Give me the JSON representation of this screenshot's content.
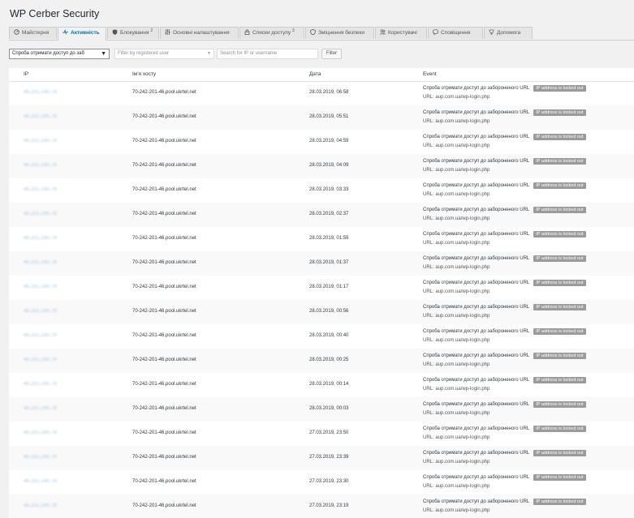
{
  "app": {
    "title": "WP Cerber Security"
  },
  "tabs": [
    {
      "label": "Майстерня",
      "icon": "dashboard-icon",
      "sup": ""
    },
    {
      "label": "Активність",
      "icon": "activity-pulse-icon",
      "sup": ""
    },
    {
      "label": "Блокування",
      "icon": "shield-icon",
      "sup": "2"
    },
    {
      "label": "Основні налаштування",
      "icon": "sliders-icon",
      "sup": ""
    },
    {
      "label": "Списки доступу",
      "icon": "lock-icon",
      "sup": "3"
    },
    {
      "label": "Зміцнення безпеки",
      "icon": "shield-outline-icon",
      "sup": ""
    },
    {
      "label": "Користувачі",
      "icon": "users-icon",
      "sup": ""
    },
    {
      "label": "Сповіщення",
      "icon": "chat-bubble-icon",
      "sup": ""
    },
    {
      "label": "Допомога",
      "icon": "lightbulb-icon",
      "sup": ""
    }
  ],
  "filters": {
    "activity_select": "Спроба отримати доступ до заб",
    "user_select_placeholder": "Filter by registered user",
    "search_placeholder": "Search for IP or username",
    "filter_button": "Filter"
  },
  "table": {
    "columns": {
      "ip": "IP",
      "host": "Ім'я хосту",
      "date": "Дата",
      "event": "Event"
    },
    "event_text": "Спроба отримати доступ до забороненого URL",
    "badge": "IP address is locked out",
    "url": "URL: aup.com.ua/wp-login.php",
    "ip_blurred": "46.201.240.79",
    "host": "70-242-201-46.pool.ukrtel.net",
    "rows": [
      {
        "date": "28.03.2019, 06:58"
      },
      {
        "date": "28.03.2019, 05:51"
      },
      {
        "date": "28.03.2019, 04:59"
      },
      {
        "date": "28.03.2019, 04:09"
      },
      {
        "date": "28.03.2019, 03:33"
      },
      {
        "date": "28.03.2019, 02:37"
      },
      {
        "date": "28.03.2019, 01:59"
      },
      {
        "date": "28.03.2019, 01:37"
      },
      {
        "date": "28.03.2019, 01:17"
      },
      {
        "date": "28.03.2019, 00:56"
      },
      {
        "date": "28.03.2019, 00:40"
      },
      {
        "date": "28.03.2019, 00:25"
      },
      {
        "date": "28.03.2019, 00:14"
      },
      {
        "date": "28.03.2019, 00:03"
      },
      {
        "date": "27.03.2019, 23:50"
      },
      {
        "date": "27.03.2019, 23:39"
      },
      {
        "date": "27.03.2019, 23:30"
      },
      {
        "date": "27.03.2019, 23:19"
      }
    ]
  },
  "colors": {
    "link": "#0073aa",
    "badge": "#9b9b9b",
    "background": "#f1f1f1"
  }
}
